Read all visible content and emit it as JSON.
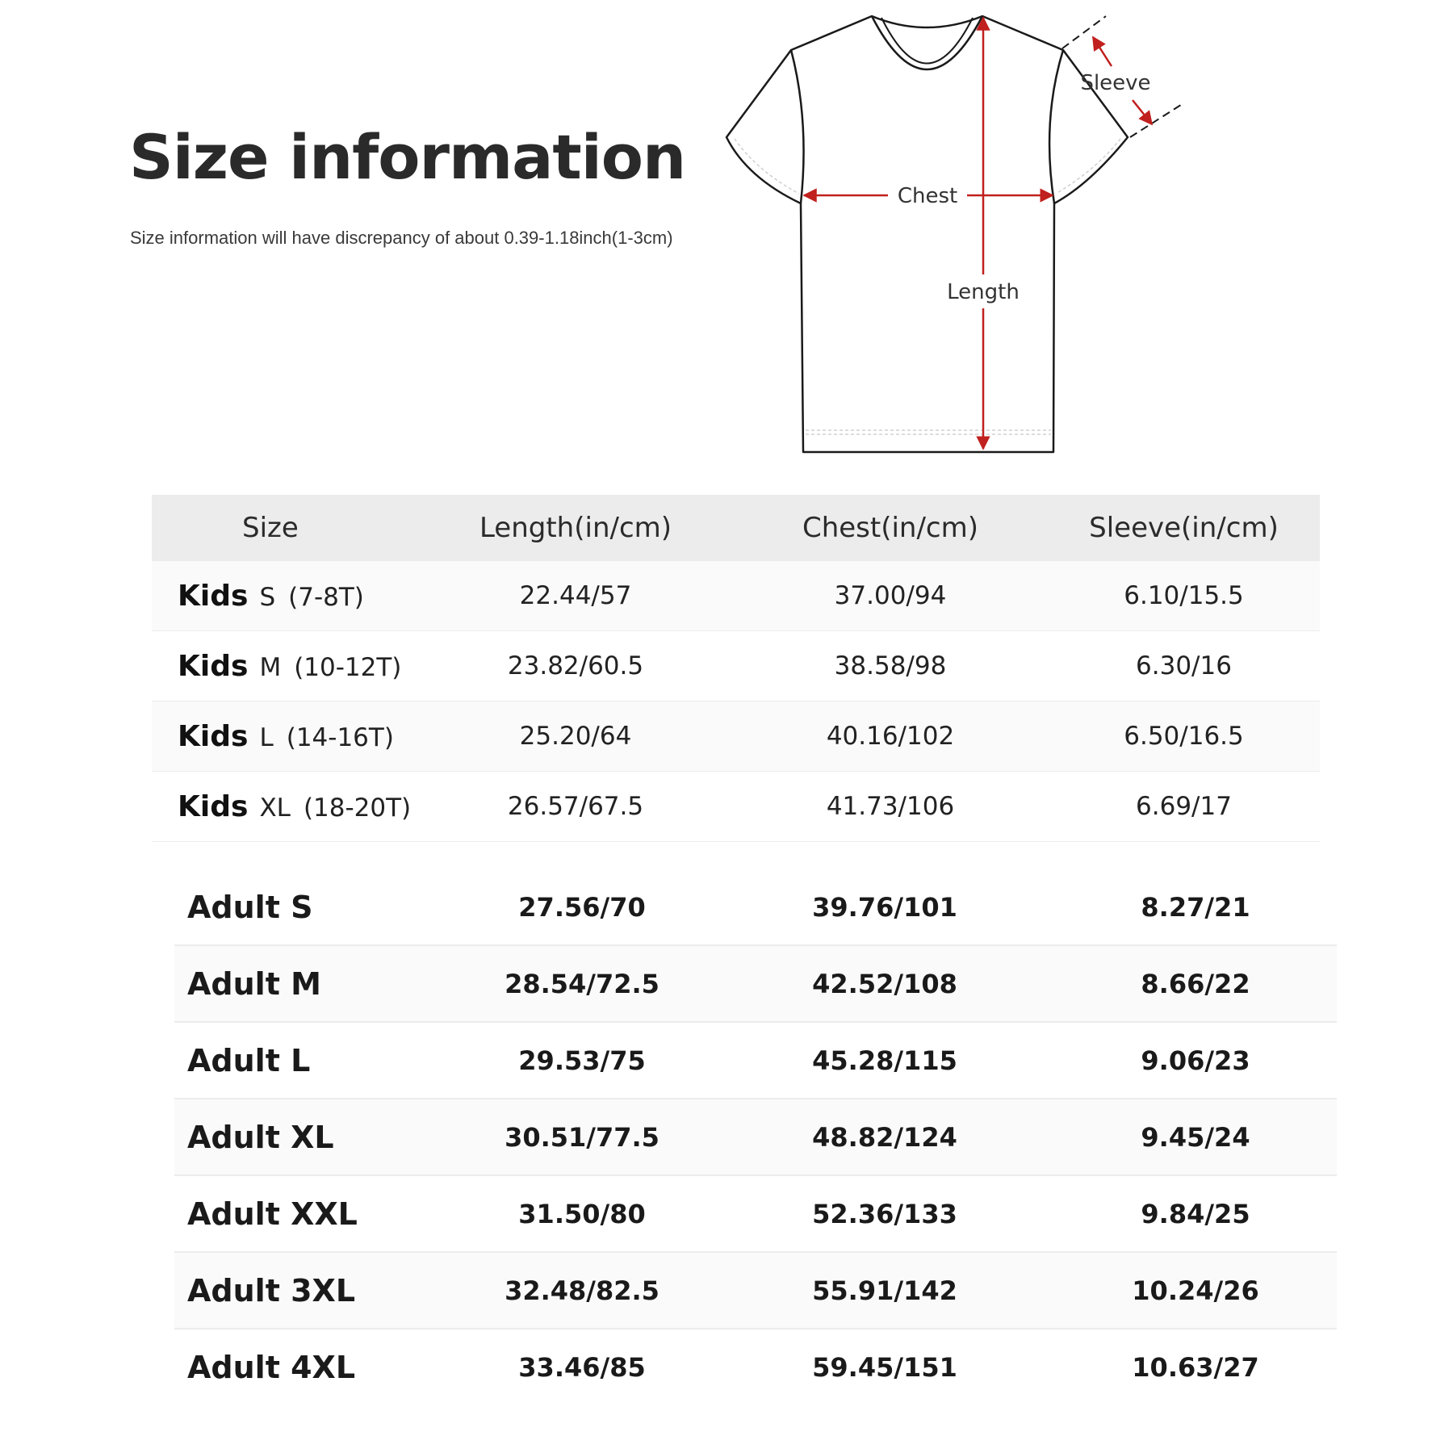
{
  "header": {
    "title": "Size information",
    "subtitle": "Size information will have discrepancy of about 0.39-1.18inch(1-3cm)"
  },
  "diagram": {
    "labels": {
      "sleeve": "Sleeve",
      "chest": "Chest",
      "length": "Length"
    },
    "colors": {
      "outline": "#1a1a1a",
      "arrow": "#c0201e"
    }
  },
  "kids_table": {
    "columns": [
      "Size",
      "Length(in/cm)",
      "Chest(in/cm)",
      "Sleeve(in/cm)"
    ],
    "rows": [
      {
        "group": "Kids",
        "size": "S",
        "age": "(7-8T)",
        "length": "22.44/57",
        "chest": "37.00/94",
        "sleeve": "6.10/15.5"
      },
      {
        "group": "Kids",
        "size": "M",
        "age": "(10-12T)",
        "length": "23.82/60.5",
        "chest": "38.58/98",
        "sleeve": "6.30/16"
      },
      {
        "group": "Kids",
        "size": "L",
        "age": "(14-16T)",
        "length": "25.20/64",
        "chest": "40.16/102",
        "sleeve": "6.50/16.5"
      },
      {
        "group": "Kids",
        "size": "XL",
        "age": "(18-20T)",
        "length": "26.57/67.5",
        "chest": "41.73/106",
        "sleeve": "6.69/17"
      }
    ]
  },
  "adult_table": {
    "rows": [
      {
        "size": "Adult S",
        "length": "27.56/70",
        "chest": "39.76/101",
        "sleeve": "8.27/21"
      },
      {
        "size": "Adult M",
        "length": "28.54/72.5",
        "chest": "42.52/108",
        "sleeve": "8.66/22"
      },
      {
        "size": "Adult L",
        "length": "29.53/75",
        "chest": "45.28/115",
        "sleeve": "9.06/23"
      },
      {
        "size": "Adult XL",
        "length": "30.51/77.5",
        "chest": "48.82/124",
        "sleeve": "9.45/24"
      },
      {
        "size": "Adult XXL",
        "length": "31.50/80",
        "chest": "52.36/133",
        "sleeve": "9.84/25"
      },
      {
        "size": "Adult 3XL",
        "length": "32.48/82.5",
        "chest": "55.91/142",
        "sleeve": "10.24/26"
      },
      {
        "size": "Adult 4XL",
        "length": "33.46/85",
        "chest": "59.45/151",
        "sleeve": "10.63/27"
      }
    ]
  }
}
